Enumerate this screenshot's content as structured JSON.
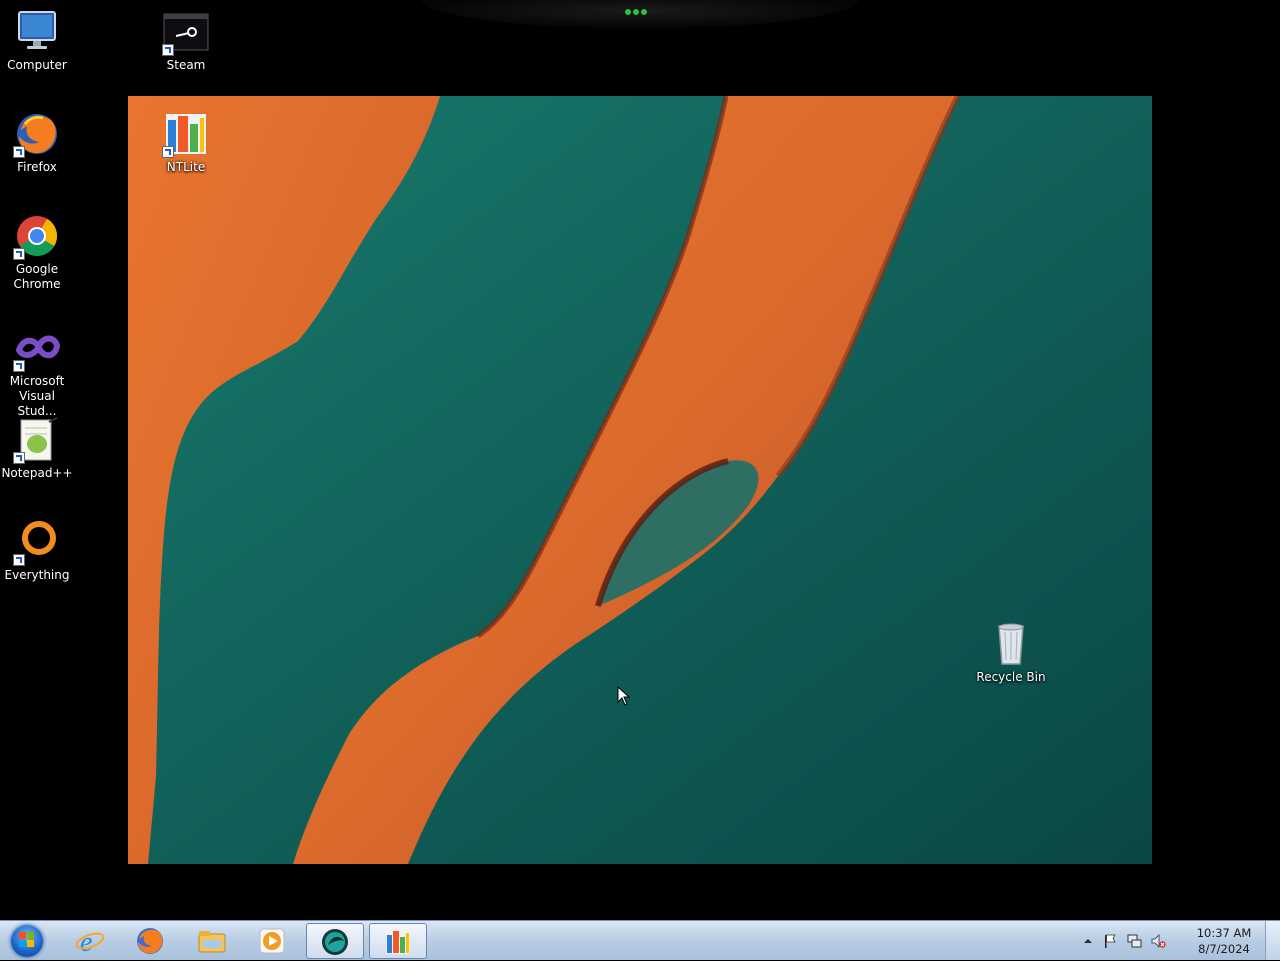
{
  "desktop": {
    "icons": [
      {
        "id": "computer",
        "label": "Computer"
      },
      {
        "id": "steam",
        "label": "Steam"
      },
      {
        "id": "firefox",
        "label": "Firefox"
      },
      {
        "id": "ntlite",
        "label": "NTLite"
      },
      {
        "id": "chrome",
        "label": "Google Chrome"
      },
      {
        "id": "visual-studio",
        "label": "Microsoft Visual Stud..."
      },
      {
        "id": "notepadpp",
        "label": "Notepad++"
      },
      {
        "id": "everything",
        "label": "Everything"
      },
      {
        "id": "recycle-bin",
        "label": "Recycle Bin"
      }
    ]
  },
  "taskbar": {
    "start_icon": "windows-orb-icon",
    "pinned": [
      {
        "name": "internet-explorer-icon"
      },
      {
        "name": "firefox-icon"
      },
      {
        "name": "file-explorer-icon"
      },
      {
        "name": "media-player-icon"
      },
      {
        "name": "teal-app-icon"
      },
      {
        "name": "ntlite-icon"
      }
    ],
    "tray": {
      "icons": [
        "show-hidden-icons-icon",
        "action-center-flag-icon",
        "network-icon",
        "volume-muted-icon"
      ],
      "time": "10:37 AM",
      "date": "8/7/2024"
    }
  },
  "colors": {
    "taskbar": "#b8cde4",
    "wallpaper_teal": "#145e56",
    "wallpaper_orange": "#e0692a"
  }
}
